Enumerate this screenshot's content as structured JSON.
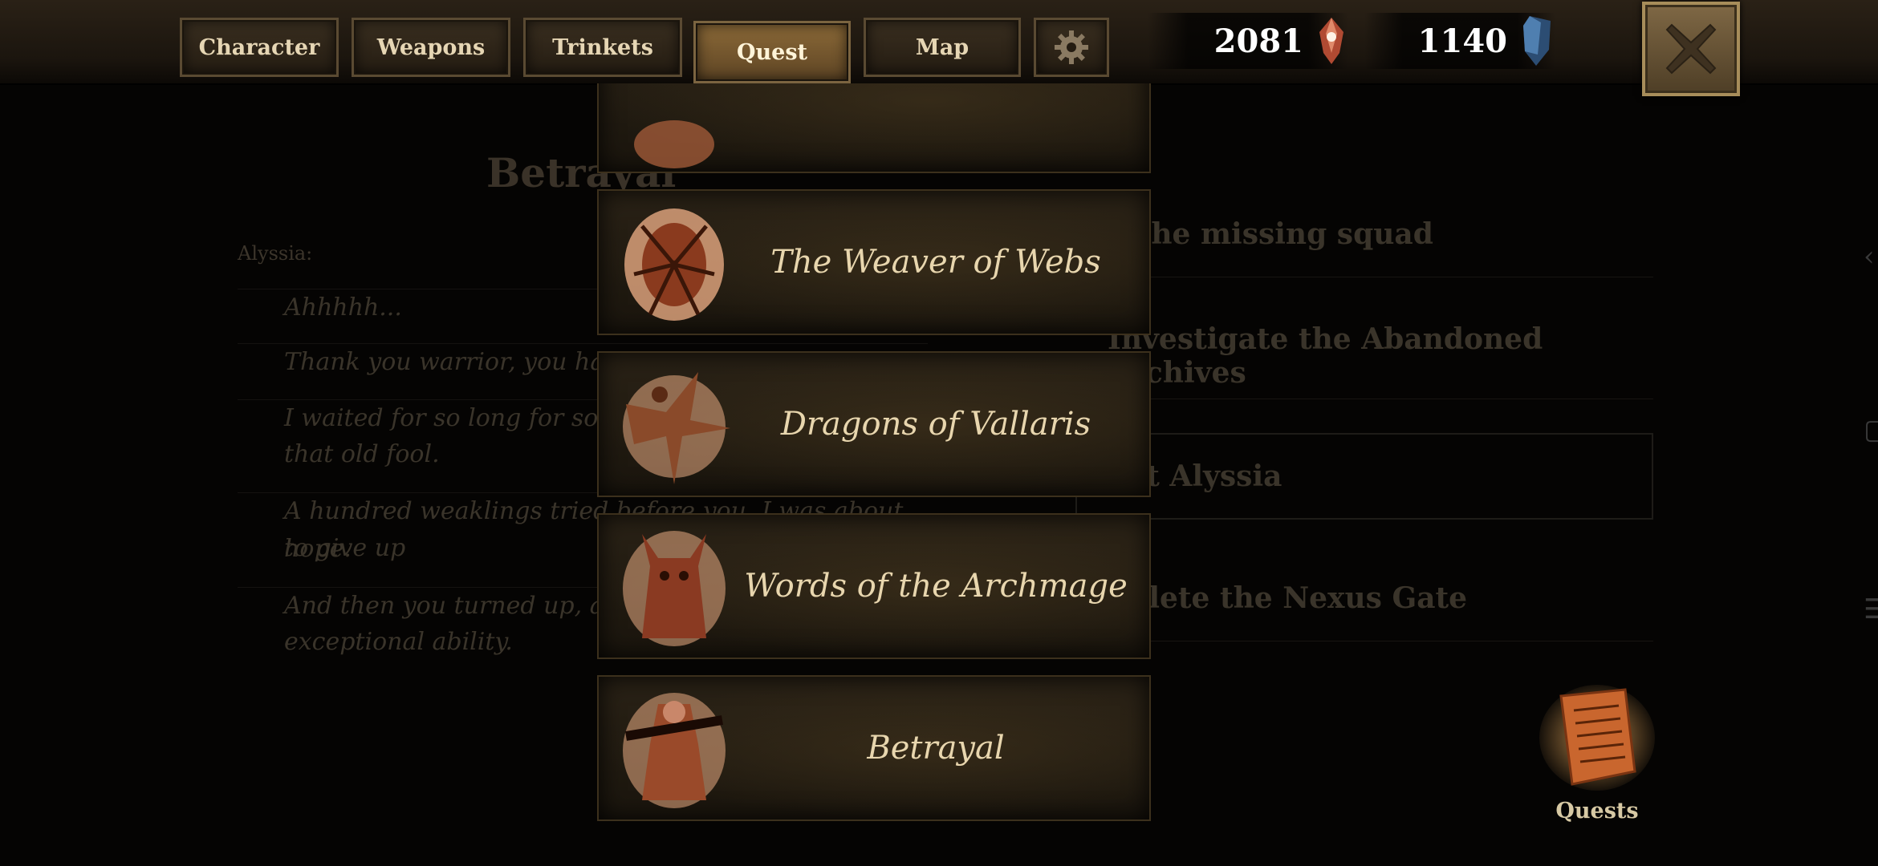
{
  "tabs": [
    {
      "label": "Character"
    },
    {
      "label": "Weapons"
    },
    {
      "label": "Trinkets"
    },
    {
      "label": "Quest"
    },
    {
      "label": "Map"
    }
  ],
  "active_tab": "Quest",
  "currency": {
    "ruby": {
      "value": "2081",
      "icon": "ruby-gem-icon"
    },
    "sapphire": {
      "value": "1140",
      "icon": "sapphire-crystal-icon"
    }
  },
  "background_quest": {
    "title": "Betrayal",
    "speaker": "Alyssia:",
    "dialogue": [
      "Ahhhhh...",
      "Thank you warrior, you have d",
      "I waited for so long for someone",
      "that old fool.",
      "A hundred weaklings tried before you. I was about to give up",
      "hope.",
      "And then you turned up, armed",
      "exceptional ability."
    ],
    "objectives": [
      "d the missing squad",
      "Investigate the Abandoned Archives",
      "eat Alyssia",
      "nplete the Nexus Gate"
    ]
  },
  "quest_list": [
    {
      "name": "The Weaver of Webs",
      "icon": "spider-creature-icon"
    },
    {
      "name": "Dragons of Vallaris",
      "icon": "dragon-icon"
    },
    {
      "name": "Words of the Archmage",
      "icon": "horned-mage-icon"
    },
    {
      "name": "Betrayal",
      "icon": "warrior-icon"
    }
  ],
  "quests_button": {
    "label": "Quests",
    "icon": "quest-scroll-icon"
  },
  "colors": {
    "accent_gold": "#e8d6ae",
    "active_tab": "#8c6a38",
    "ruby": "#c2553a",
    "sapphire": "#3f6a9a"
  }
}
